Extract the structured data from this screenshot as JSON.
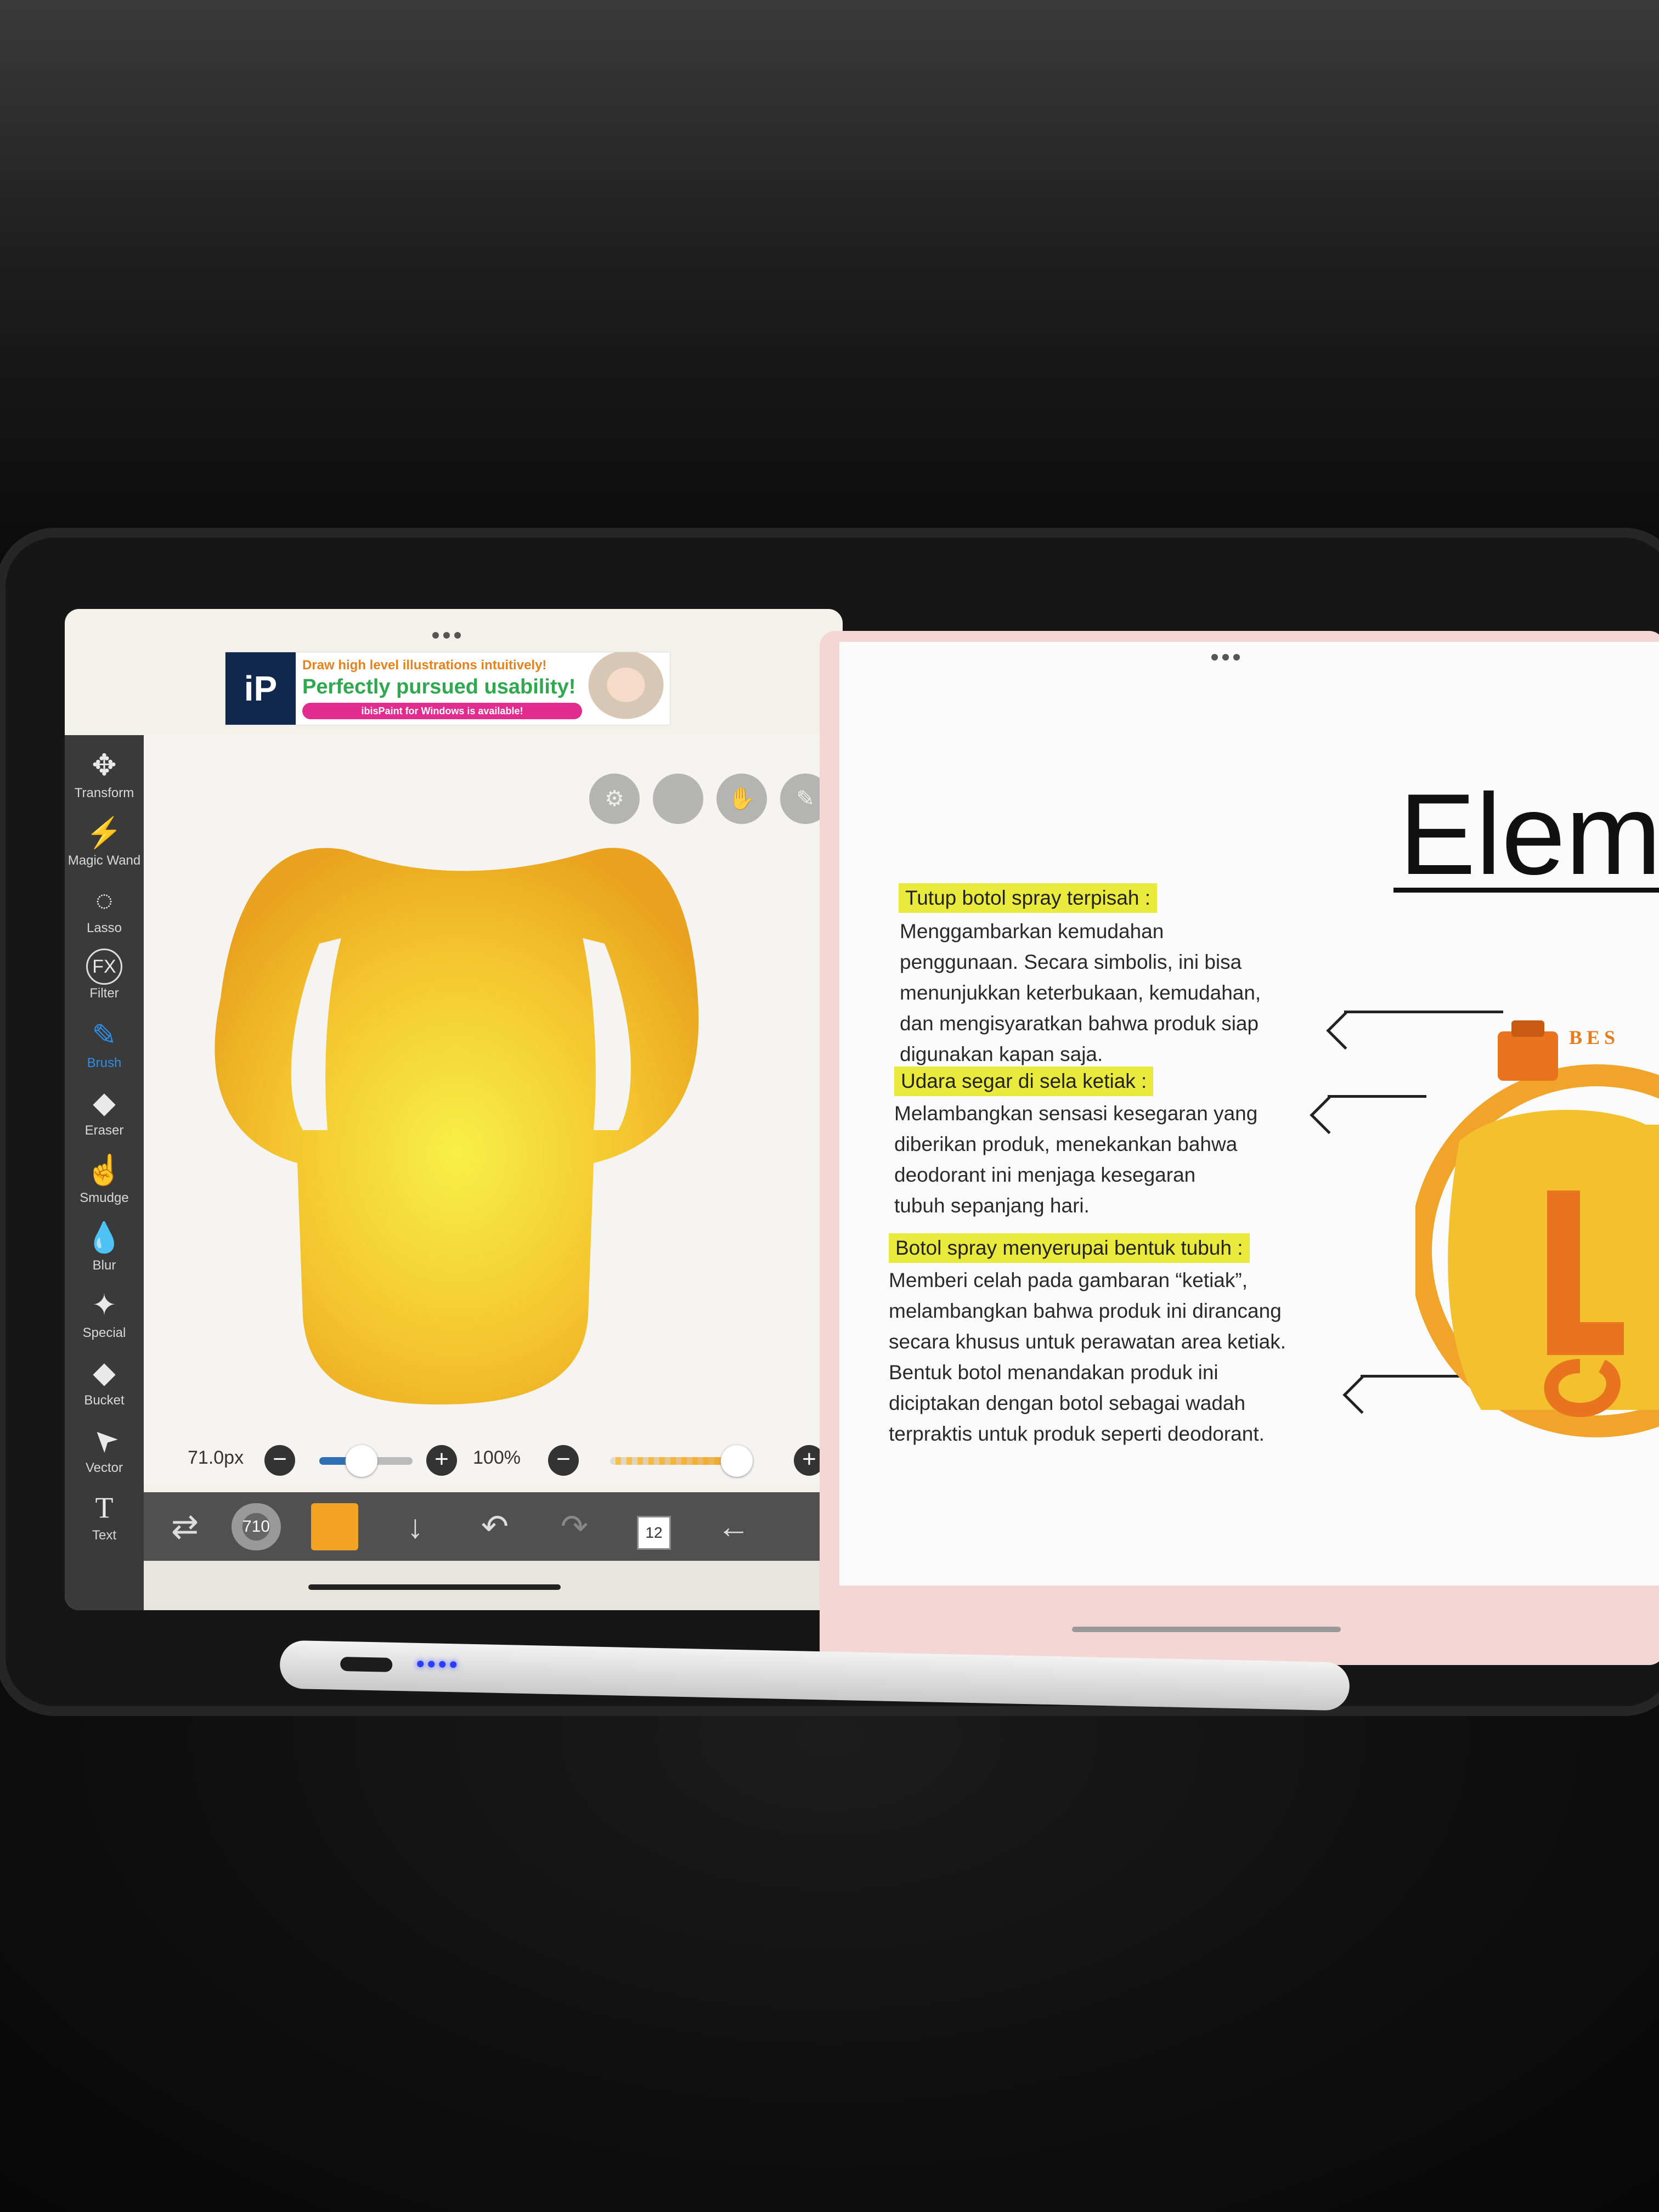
{
  "ibispaint": {
    "ad": {
      "logo": "iP",
      "line1": "Draw high level illustrations intuitively!",
      "line2": "Perfectly pursued usability!",
      "line3": "ibisPaint for Windows is available!"
    },
    "tools": [
      {
        "label": "Transform",
        "icon": "move-arrows-icon",
        "glyph": "✥"
      },
      {
        "label": "Magic Wand",
        "icon": "magic-wand-icon",
        "glyph": "⚡"
      },
      {
        "label": "Lasso",
        "icon": "lasso-icon",
        "glyph": "◌"
      },
      {
        "label": "Filter",
        "icon": "filter-fx-icon",
        "glyph": "FX"
      },
      {
        "label": "Brush",
        "icon": "brush-icon",
        "glyph": "✎"
      },
      {
        "label": "Eraser",
        "icon": "eraser-icon",
        "glyph": "◆"
      },
      {
        "label": "Smudge",
        "icon": "smudge-icon",
        "glyph": "☝"
      },
      {
        "label": "Blur",
        "icon": "blur-drop-icon",
        "glyph": "💧"
      },
      {
        "label": "Special",
        "icon": "special-wand-icon",
        "glyph": "✦"
      },
      {
        "label": "Bucket",
        "icon": "bucket-icon",
        "glyph": "◆"
      },
      {
        "label": "Vector",
        "icon": "vector-cursor-icon",
        "glyph": "➤"
      },
      {
        "label": "Text",
        "icon": "text-icon",
        "glyph": "T"
      }
    ],
    "active_tool": "Brush",
    "brush_size": "71.0px",
    "opacity": "100%",
    "brush_size_slider_level": 0.45,
    "opacity_slider_level": 1.0,
    "bottom_bar": {
      "brush_thumb_label": "710",
      "color": "#f2a324",
      "layers_count": "12"
    }
  },
  "document": {
    "title": "Elem",
    "sections": [
      {
        "heading": "Tutup botol spray terpisah :",
        "lines": [
          "Menggambarkan kemudahan",
          "penggunaan. Secara simbolis, ini bisa",
          "menunjukkan keterbukaan, kemudahan,",
          "dan mengisyaratkan bahwa produk siap",
          "digunakan kapan saja."
        ]
      },
      {
        "heading": "Udara segar di sela ketiak :",
        "lines": [
          "Melambangkan sensasi kesegaran yang",
          "diberikan produk, menekankan bahwa",
          "deodorant ini menjaga kesegaran",
          "tubuh sepanjang hari."
        ]
      },
      {
        "heading": "Botol spray menyerupai bentuk tubuh :",
        "lines": [
          "Memberi celah pada gambaran “ketiak”,",
          "melambangkan bahwa produk ini dirancang",
          "secara khusus untuk perawatan area ketiak.",
          "Bentuk botol menandakan produk ini",
          "diciptakan dengan botol sebagai wadah",
          "terpraktis untuk produk seperti deodorant."
        ]
      }
    ],
    "product_brand_text": "BES",
    "highlight_color": "#e9ea3c"
  }
}
